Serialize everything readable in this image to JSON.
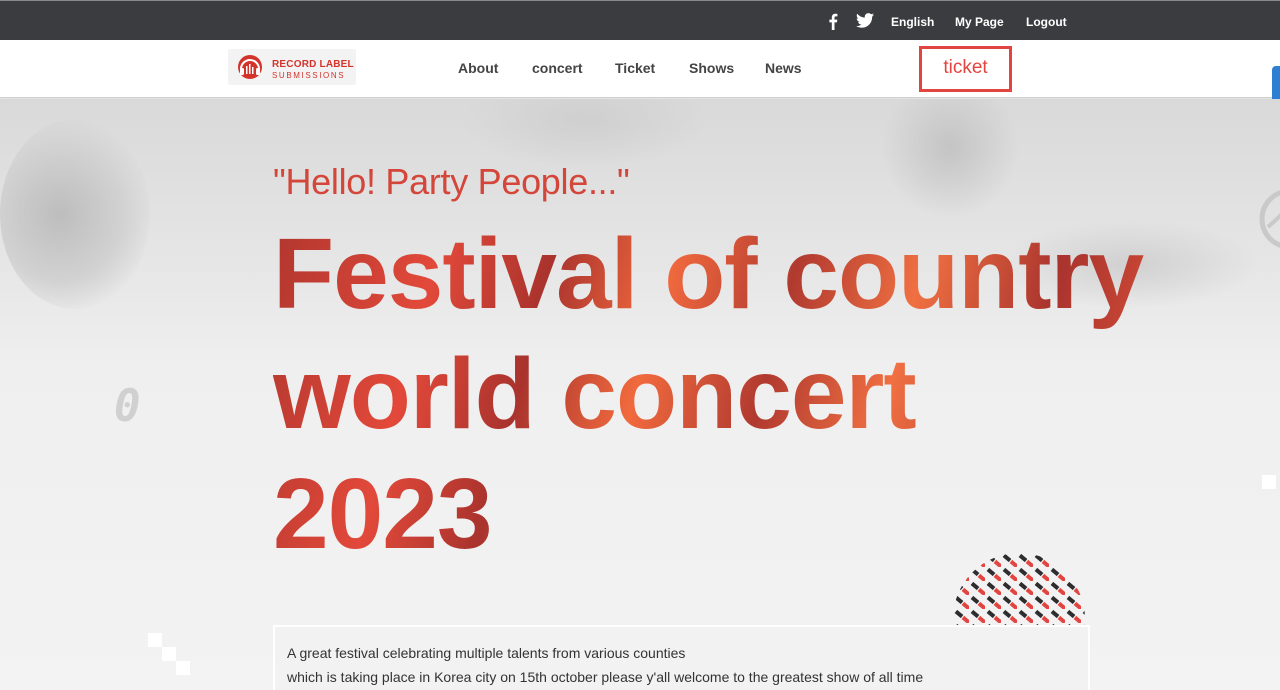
{
  "topbar": {
    "social": [
      {
        "icon": "facebook-icon"
      },
      {
        "icon": "twitter-icon"
      }
    ],
    "links": {
      "english": "English",
      "my_page": "My Page",
      "logout": "Logout"
    }
  },
  "nav": {
    "logo": {
      "line1": "RECORD LABEL",
      "line2": "SUBMISSIONS"
    },
    "items": [
      {
        "label": "About"
      },
      {
        "label": "concert"
      },
      {
        "label": "Ticket"
      },
      {
        "label": "Shows"
      },
      {
        "label": "News"
      }
    ],
    "ticket_button": "ticket"
  },
  "hero": {
    "tagline": "\"Hello! Party People...\"",
    "headline": {
      "line1": "Festival of country",
      "line2": "world concert",
      "line3": "2023"
    },
    "decor_digit": "0",
    "description": {
      "line1": "A great festival celebrating multiple talents from various counties",
      "line2": "which is taking place in Korea city on 15th october please y'all welcome to the greatest show of all time"
    }
  },
  "colors": {
    "accent": "#e2453f",
    "topbar": "#3b3c3f",
    "link_blue_tab": "#2d7fd3"
  }
}
